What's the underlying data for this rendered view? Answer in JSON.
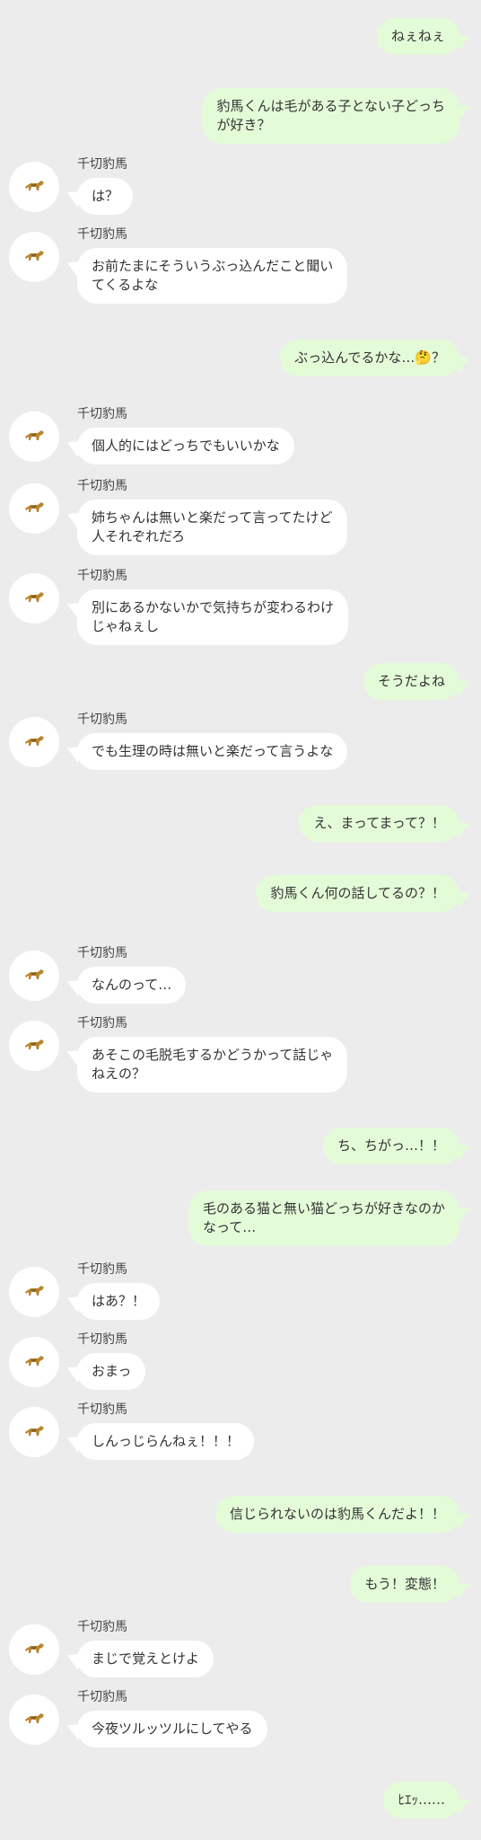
{
  "contact": {
    "name": "千切豹馬",
    "avatar_icon": "leopard-icon"
  },
  "messages": [
    {
      "from": "me",
      "lines": [
        "ねぇねぇ"
      ]
    },
    {
      "from": "me",
      "lines": [
        "豹馬くんは毛がある子とない子どっち",
        "が好き？"
      ]
    },
    {
      "from": "other",
      "lines": [
        "は？"
      ]
    },
    {
      "from": "other",
      "lines": [
        "お前たまにそういうぶっ込んだこと聞い",
        "てくるよな"
      ]
    },
    {
      "from": "me",
      "lines": [
        "ぶっ込んでるかな…🤔？"
      ]
    },
    {
      "from": "other",
      "lines": [
        "個人的にはどっちでもいいかな"
      ]
    },
    {
      "from": "other",
      "lines": [
        "姉ちゃんは無いと楽だって言ってたけど",
        "人それぞれだろ"
      ]
    },
    {
      "from": "other",
      "lines": [
        "別にあるかないかで気持ちが変わるわけ",
        "じゃねぇし"
      ]
    },
    {
      "from": "me",
      "lines": [
        "そうだよね"
      ]
    },
    {
      "from": "other",
      "lines": [
        "でも生理の時は無いと楽だって言うよな"
      ]
    },
    {
      "from": "me",
      "lines": [
        "え、まってまって？！"
      ]
    },
    {
      "from": "me",
      "lines": [
        "豹馬くん何の話してるの？！"
      ]
    },
    {
      "from": "other",
      "lines": [
        "なんのって…"
      ]
    },
    {
      "from": "other",
      "lines": [
        "あそこの毛脱毛するかどうかって話じゃ",
        "ねえの？"
      ]
    },
    {
      "from": "me",
      "lines": [
        "ち、ちがっ…！！"
      ]
    },
    {
      "from": "me",
      "lines": [
        "毛のある猫と無い猫どっちが好きなのか",
        "なって…"
      ]
    },
    {
      "from": "other",
      "lines": [
        "はあ？！"
      ]
    },
    {
      "from": "other",
      "lines": [
        "おまっ"
      ]
    },
    {
      "from": "other",
      "lines": [
        "しんっじらんねぇ！！！"
      ]
    },
    {
      "from": "me",
      "lines": [
        "信じられないのは豹馬くんだよ！！"
      ]
    },
    {
      "from": "me",
      "lines": [
        "もう！変態！"
      ]
    },
    {
      "from": "other",
      "lines": [
        "まじで覚えとけよ"
      ]
    },
    {
      "from": "other",
      "lines": [
        "今夜ツルッツルにしてやる"
      ]
    },
    {
      "from": "me",
      "lines": [
        "ﾋｴｯ……"
      ]
    }
  ]
}
